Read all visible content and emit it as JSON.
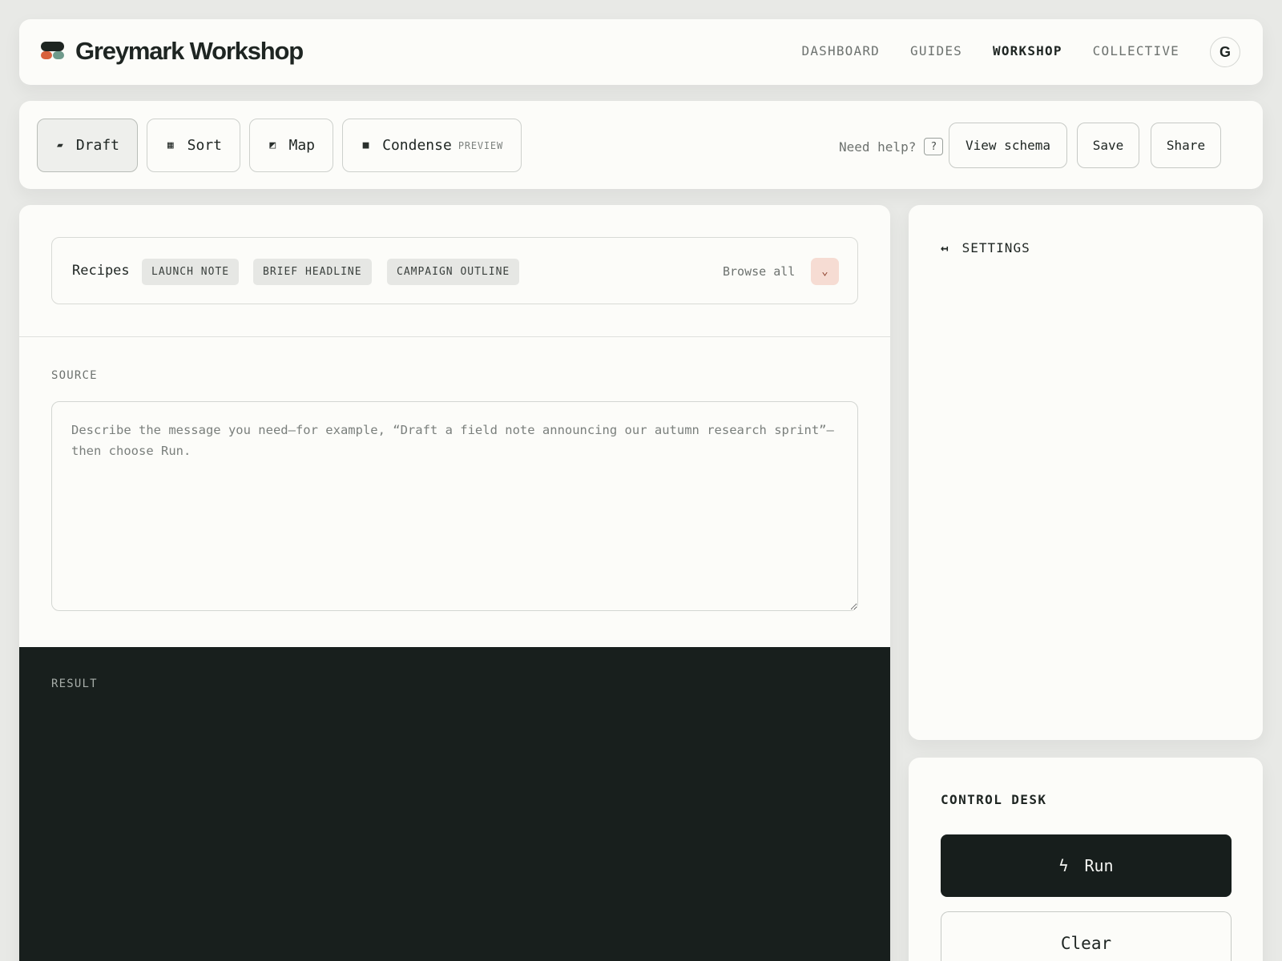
{
  "header": {
    "brand": "Greymark Workshop",
    "nav": [
      "DASHBOARD",
      "GUIDES",
      "WORKSHOP",
      "COLLECTIVE"
    ],
    "active_nav": "WORKSHOP",
    "avatar_initial": "G"
  },
  "toolbar": {
    "modes": [
      {
        "label": "Draft",
        "icon": "pen-icon",
        "glyph": "▰",
        "active": true
      },
      {
        "label": "Sort",
        "icon": "grid-icon",
        "glyph": "▦"
      },
      {
        "label": "Map",
        "icon": "map-icon",
        "glyph": "◩"
      },
      {
        "label": "Condense",
        "icon": "square-icon",
        "glyph": "■",
        "badge": "PREVIEW"
      }
    ],
    "help_text": "Need help?",
    "help_glyph": "?",
    "view_schema": "View schema",
    "save": "Save",
    "share": "Share"
  },
  "recipes": {
    "label": "Recipes",
    "items": [
      "LAUNCH NOTE",
      "BRIEF HEADLINE",
      "CAMPAIGN OUTLINE"
    ],
    "browse": "Browse all",
    "dropdown_glyph": "⌄"
  },
  "source": {
    "label": "SOURCE",
    "value": "",
    "placeholder": "Describe the message you need—for example, “Draft a field note announcing our autumn research sprint”—then choose Run."
  },
  "result": {
    "label": "RESULT"
  },
  "settings": {
    "label": "SETTINGS",
    "arrow_glyph": "↤"
  },
  "control_desk": {
    "title": "CONTROL DESK",
    "run": "Run",
    "run_glyph": "ϟ",
    "clear": "Clear"
  },
  "colors": {
    "background": "#e8e9e6",
    "panel": "#fcfcf9",
    "ink": "#1e2522",
    "result_bg": "#181f1d",
    "accent_orange": "#d8613c",
    "accent_sage": "#6f9a8b",
    "dropdown_tint": "#f6dcd3"
  }
}
